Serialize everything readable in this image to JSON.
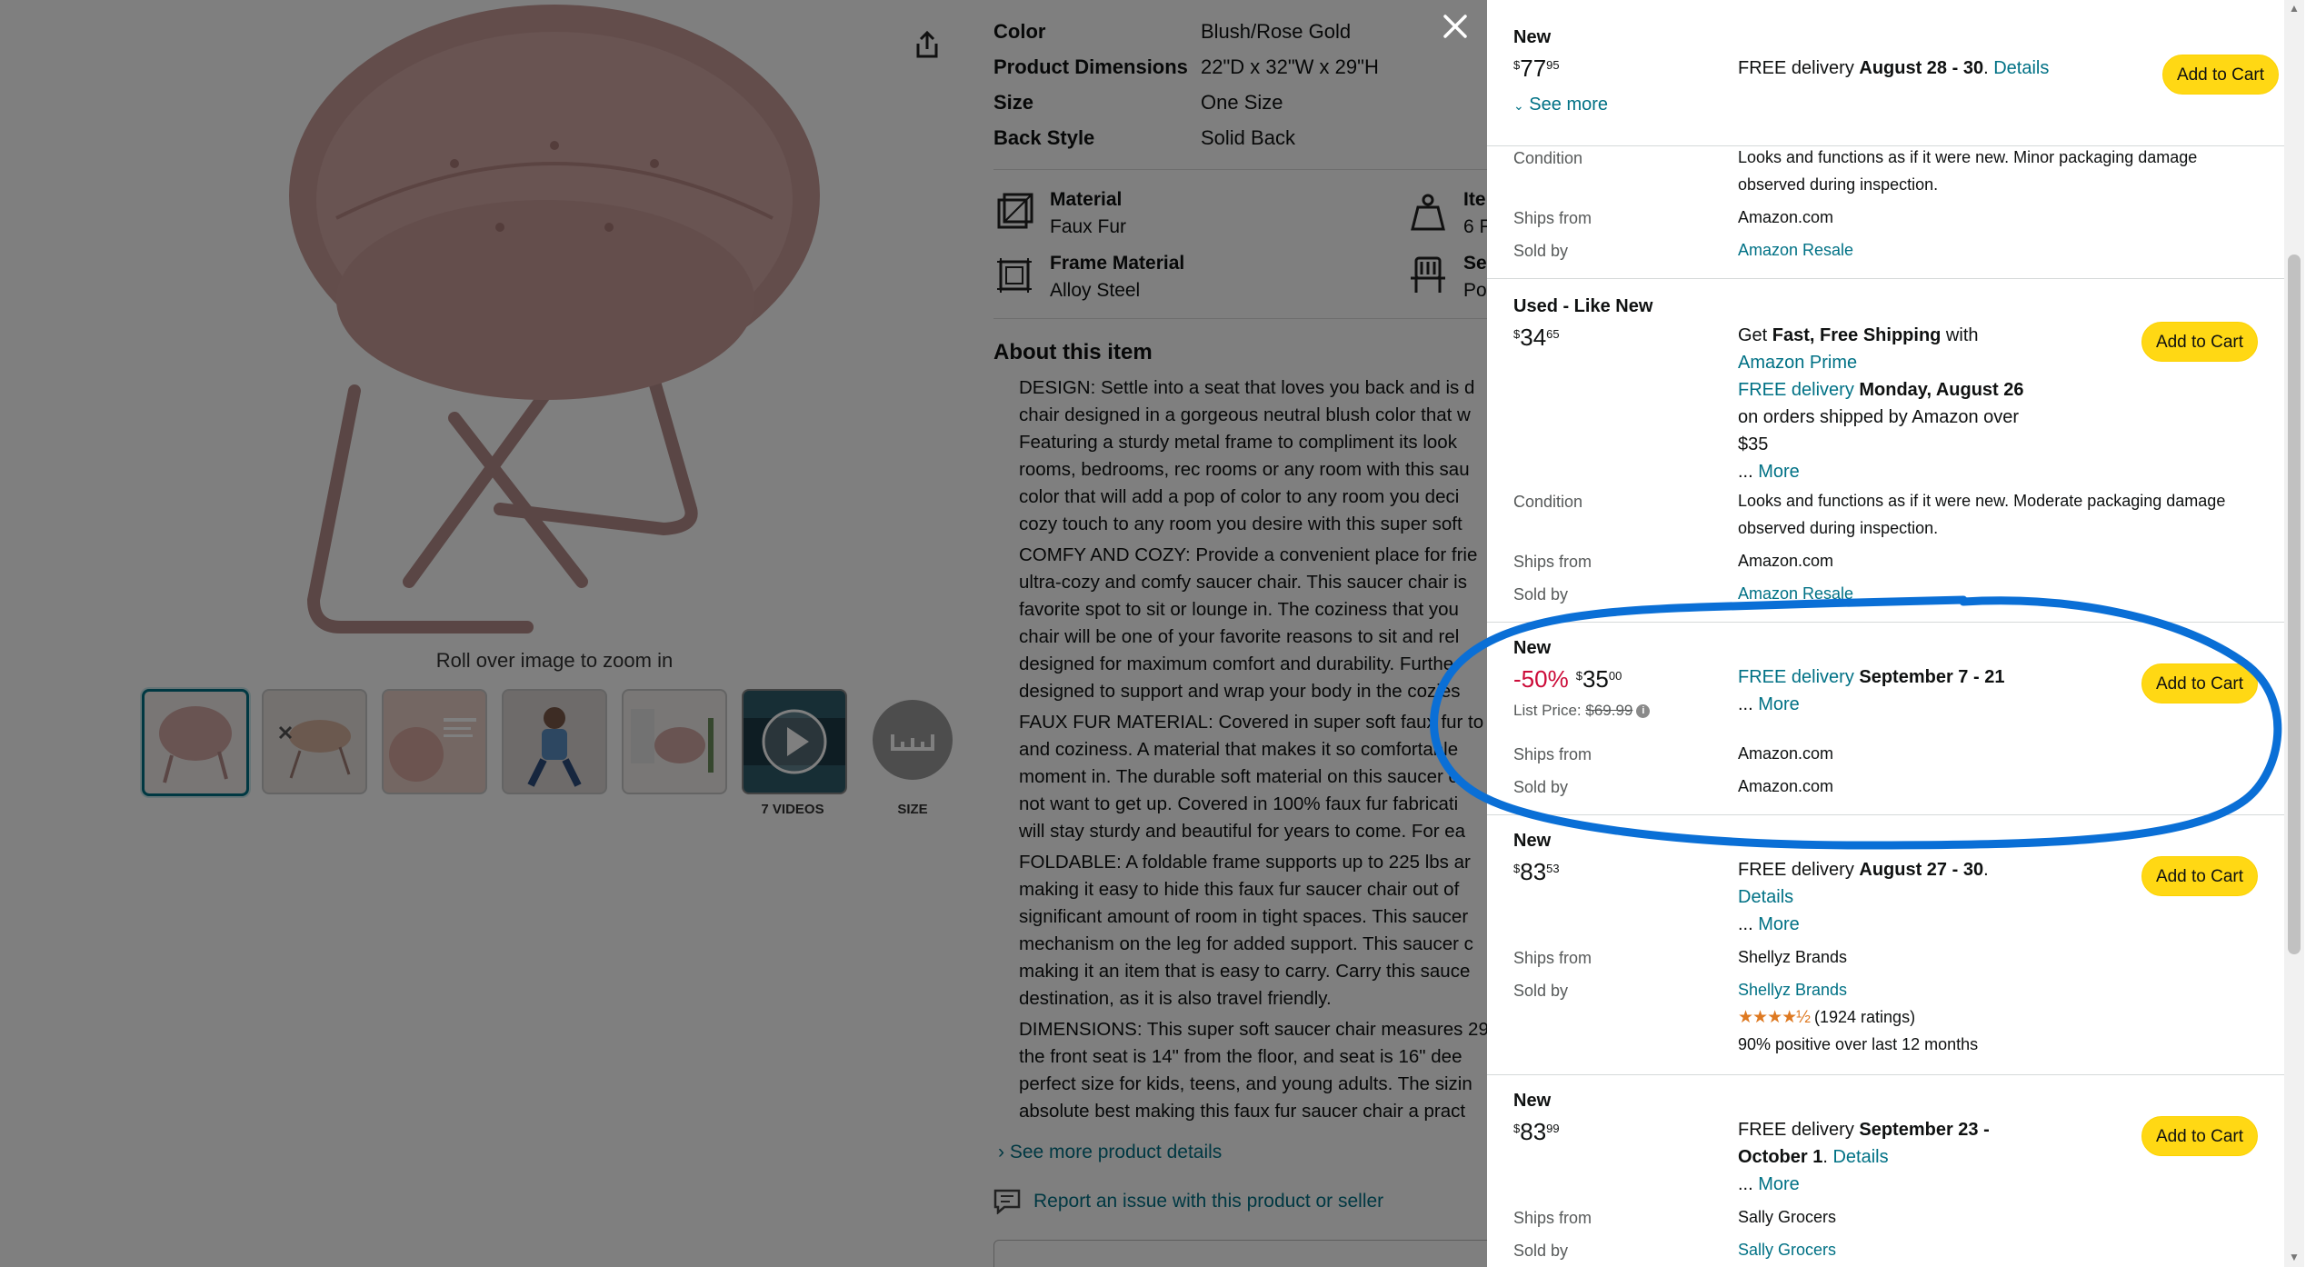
{
  "product_specs": [
    {
      "key": "Color",
      "value": "Blush/Rose Gold"
    },
    {
      "key": "Product Dimensions",
      "value": "22\"D x 32\"W x 29\"H"
    },
    {
      "key": "Size",
      "value": "One Size"
    },
    {
      "key": "Back Style",
      "value": "Solid Back"
    }
  ],
  "features": [
    {
      "key": "Material",
      "value": "Faux Fur",
      "icon": "material-icon"
    },
    {
      "key": "Ite",
      "value": "6 F",
      "icon": "weight-icon"
    },
    {
      "key": "Frame Material",
      "value": "Alloy Steel",
      "icon": "frame-icon"
    },
    {
      "key": "Se",
      "value": "Po",
      "icon": "seat-icon"
    }
  ],
  "zoom_hint": "Roll over image to zoom in",
  "thumb_captions": {
    "videos": "7 VIDEOS",
    "size": "SIZE"
  },
  "about": {
    "title": "About this item",
    "bullets": [
      [
        "DESIGN: Settle into a seat that loves you back and is d",
        "chair designed in a gorgeous neutral blush color that w",
        "Featuring a sturdy metal frame to compliment its look",
        "rooms, bedrooms, rec rooms or any room with this sau",
        "color that will add a pop of color to any room you deci",
        "cozy touch to any room you desire with this super soft"
      ],
      [
        "COMFY AND COZY: Provide a convenient place for frie",
        "ultra-cozy and comfy saucer chair. This saucer chair is",
        "favorite spot to sit or lounge in. The coziness that you",
        "chair will be one of your favorite reasons to sit and rel",
        "designed for maximum comfort and durability. Furthe",
        "designed to support and wrap your body in the cozies"
      ],
      [
        "FAUX FUR MATERIAL: Covered in super soft faux fur to",
        "and coziness. A material that makes it so comfortable",
        "moment in. The durable soft material on this saucer c",
        "not want to get up. Covered in 100% faux fur fabricati",
        "will stay sturdy and beautiful for years to come. For ea"
      ],
      [
        "FOLDABLE: A foldable frame supports up to 225 lbs ar",
        "making it easy to hide this faux fur saucer chair out of",
        "significant amount of room in tight spaces. This saucer",
        "mechanism on the leg for added support. This saucer c",
        "making it an item that is easy to carry. Carry this sauce",
        "destination, as it is also travel friendly."
      ],
      [
        "DIMENSIONS: This super soft saucer chair measures 29",
        "the front seat is 14\" from the floor, and seat is 16\" dee",
        "perfect size for kids, teens, and young adults. The sizin",
        "absolute best making this faux fur saucer chair a pract"
      ]
    ],
    "see_more": "See more product details"
  },
  "report_link": "Report an issue with this product or seller",
  "offers": {
    "top": {
      "condition": "New",
      "price_whole": "77",
      "price_frac": "95",
      "delivery_prefix": "FREE delivery ",
      "delivery_date": "August 28 - 30",
      "details": "Details",
      "see_more": "See more",
      "condition_label": "Condition",
      "condition_text_1": "Looks and functions as if it were new. Minor packaging damage",
      "condition_text_2": "observed during inspection.",
      "ships_from_label": "Ships from",
      "ships_from": "Amazon.com",
      "sold_by_label": "Sold by",
      "sold_by": "Amazon Resale"
    },
    "used": {
      "condition": "Used - Like New",
      "price_whole": "34",
      "price_frac": "65",
      "line1_a": "Get ",
      "line1_b": "Fast, Free Shipping",
      "line1_c": " with",
      "prime": "Amazon Prime",
      "free_delivery": "FREE delivery",
      "delivery_date": " Monday, August 26",
      "line4": "on orders shipped by Amazon over",
      "line5": "$35",
      "more": "More",
      "condition_label": "Condition",
      "condition_text_1": "Looks and functions as if it were new. Moderate packaging damage",
      "condition_text_2": "observed during inspection.",
      "ships_from_label": "Ships from",
      "ships_from": "Amazon.com",
      "sold_by_label": "Sold by",
      "sold_by": "Amazon Resale"
    },
    "sale": {
      "condition": "New",
      "discount": "-50%",
      "price_whole": "35",
      "price_frac": "00",
      "list_price_label": "List Price: ",
      "list_price": "$69.99",
      "free_delivery": "FREE delivery",
      "delivery_date": " September 7 - 21",
      "more": "More",
      "ships_from_label": "Ships from",
      "ships_from": "Amazon.com",
      "sold_by_label": "Sold by",
      "sold_by": "Amazon.com"
    },
    "shellyz": {
      "condition": "New",
      "price_whole": "83",
      "price_frac": "53",
      "delivery_prefix": "FREE delivery ",
      "delivery_date": "August 27 - 30",
      "details": "Details",
      "more": "More",
      "ships_from_label": "Ships from",
      "ships_from": "Shellyz Brands",
      "sold_by_label": "Sold by",
      "sold_by": "Shellyz Brands",
      "stars": "★★★★½",
      "ratings": "(1924 ratings)",
      "positive": "90% positive over last 12 months"
    },
    "sally": {
      "condition": "New",
      "price_whole": "83",
      "price_frac": "99",
      "delivery_prefix": "FREE delivery ",
      "delivery_date_1": "September 23 -",
      "delivery_date_2": "October 1",
      "details": "Details",
      "more": "More",
      "ships_from_label": "Ships from",
      "ships_from": "Sally Grocers",
      "sold_by_label": "Sold by",
      "sold_by": "Sally Grocers"
    },
    "add_to_cart": "Add to Cart",
    "ellipsis": "... ",
    "currency": "$"
  },
  "colors": {
    "link": "#007185",
    "button": "#FFD814",
    "discount": "#CC0C39",
    "annotation": "#0A6FD6"
  }
}
